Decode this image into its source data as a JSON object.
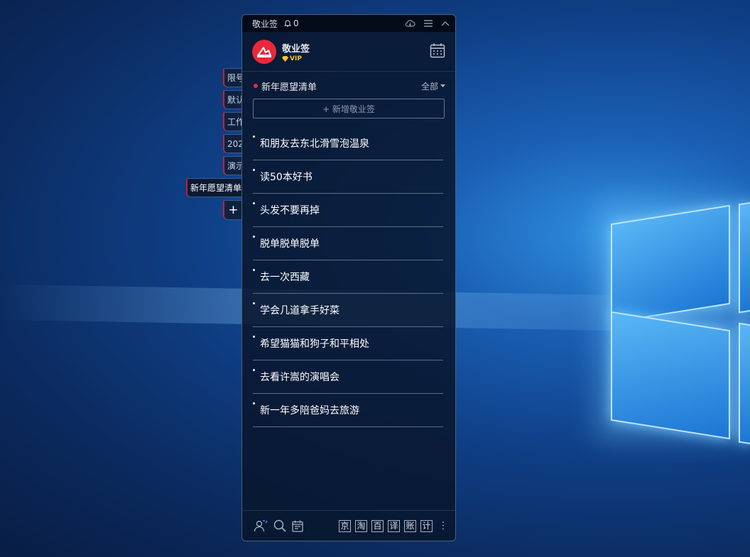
{
  "titlebar": {
    "app_name": "敬业签",
    "notification_count": "0"
  },
  "user": {
    "name": "敬业签",
    "badge": "VIP"
  },
  "side_tabs": [
    {
      "label": "限号"
    },
    {
      "label": "默认"
    },
    {
      "label": "工作"
    },
    {
      "label": "202"
    },
    {
      "label": "演示"
    },
    {
      "label": "新年愿望清单"
    }
  ],
  "list": {
    "name": "新年愿望清单",
    "filter": "全部",
    "add_button": "+ 新增敬业签",
    "items": [
      "和朋友去东北滑雪泡温泉",
      "读50本好书",
      "头发不要再掉",
      "脱单脱单脱单",
      "去一次西藏",
      "学会几道拿手好菜",
      "希望猫猫和狗子和平相处",
      "去看许嵩的演唱会",
      "新一年多陪爸妈去旅游"
    ]
  },
  "footer": {
    "quick_buttons": [
      "京",
      "淘",
      "百",
      "译",
      "账",
      "计"
    ]
  },
  "colors": {
    "accent": "#e8293a",
    "vip": "#f5c623"
  }
}
